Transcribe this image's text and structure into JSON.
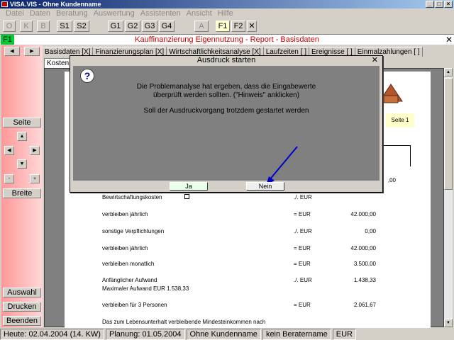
{
  "window": {
    "title": "VISA.VIS - Ohne Kundenname"
  },
  "menu": [
    "Datei",
    "Daten",
    "Beratung",
    "Auswertung",
    "Assistenten",
    "Ansicht",
    "Hilfe"
  ],
  "toolbar": {
    "buttons": [
      "O",
      "K",
      "B",
      "S1",
      "S2",
      "G1",
      "G2",
      "G3",
      "G4",
      "A",
      "F1",
      "F2"
    ],
    "close": "✕"
  },
  "header": {
    "badge": "F1",
    "title": "Kauffinanzierung Eigennutzung - Report - Basisdaten",
    "close": "✕"
  },
  "tabs": [
    "Basisdaten [X]",
    "Finanzierungsplan [X]",
    "Wirtschaftlichkeitsanalyse [X]",
    "Laufzeiten [ ]",
    "Ereignisse [ ]",
    "Einmalzahlungen [ ]"
  ],
  "subtab": "Kosten",
  "sidebar": {
    "seite": "Seite",
    "zoom_minus": "-",
    "zoom_plus": "+",
    "breite": "Breite",
    "auswahl": "Auswahl",
    "drucken": "Drucken",
    "beenden": "Beenden"
  },
  "report": {
    "seite_label": "Seite 1",
    "rows": [
      {
        "label": "",
        "op": "",
        "value": ",00"
      },
      {
        "label": "Bewirtschaftungskosten",
        "op": "./. EUR",
        "value": ""
      },
      {
        "label": "verbleiben jährlich",
        "op": "= EUR",
        "value": "42.000,00"
      },
      {
        "label": "sonstige Verpflichtungen",
        "op": "./. EUR",
        "value": "0,00"
      },
      {
        "label": "verbleiben jährlich",
        "op": "= EUR",
        "value": "42.000,00"
      },
      {
        "label": "verbleiben monatlich",
        "op": "= EUR",
        "value": "3.500,00"
      },
      {
        "label": "Anfänglicher Aufwand",
        "op": "./. EUR",
        "value": "1.438,33"
      },
      {
        "label": "Maximaler Aufwand  EUR  1.538,33",
        "op": "",
        "value": ""
      },
      {
        "label": "verbleiben für 3 Personen",
        "op": "= EUR",
        "value": "2.061,67"
      },
      {
        "label": "Das zum Lebensunterhalt verbleibende Mindesteinkommen nach",
        "op": "",
        "value": ""
      }
    ]
  },
  "dialog": {
    "title": "Ausdruck starten",
    "close": "✕",
    "icon": "?",
    "message_line1": "Die Problemanalyse hat ergeben, dass die Eingabewerte",
    "message_line2": "überprüft werden sollten. (\"Hinweis\" anklicken)",
    "message_line3": "Soll der Ausdruckvorgang trotzdem gestartet werden",
    "yes_label": "Ja",
    "no_label": "Nein"
  },
  "status": [
    "Heute: 02.04.2004 (14. KW)",
    "Planung: 01.05.2004",
    "Ohne Kundenname",
    "kein Beratername",
    "EUR"
  ]
}
